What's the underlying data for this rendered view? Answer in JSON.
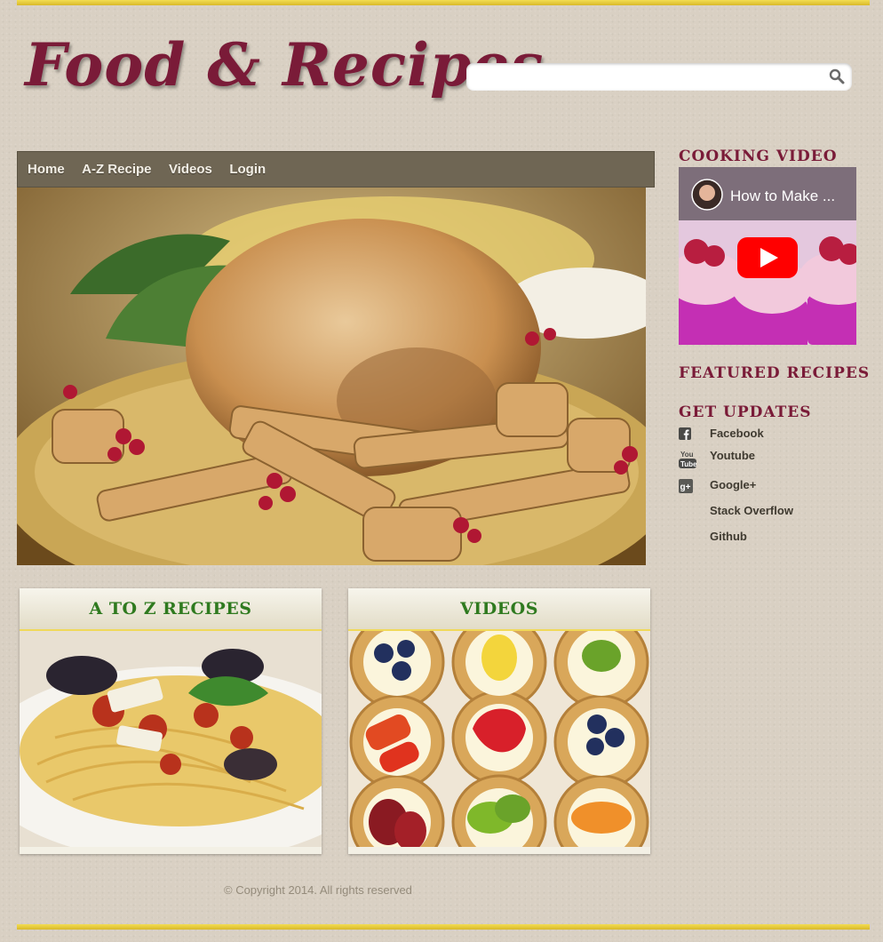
{
  "brand": {
    "logo_text": "Food & Recipes"
  },
  "search": {
    "value": "",
    "placeholder": ""
  },
  "nav": {
    "items": [
      {
        "label": "Home"
      },
      {
        "label": "A-Z Recipe"
      },
      {
        "label": "Videos"
      },
      {
        "label": "Login"
      }
    ]
  },
  "panels": {
    "az": {
      "title": "A TO Z RECIPES"
    },
    "videos": {
      "title": "VIDEOS"
    }
  },
  "sidebar": {
    "cooking_video": {
      "title": "COOKING VIDEO",
      "video_title": "How to Make ..."
    },
    "featured": {
      "title": "FEATURED RECIPES"
    },
    "updates": {
      "title": "GET UPDATES",
      "items": [
        {
          "label": "Facebook",
          "icon": "facebook-icon"
        },
        {
          "label": "Youtube",
          "icon": "youtube-icon"
        },
        {
          "label": "Google+",
          "icon": "google-plus-icon"
        },
        {
          "label": "Stack Overflow",
          "icon": ""
        },
        {
          "label": "Github",
          "icon": ""
        }
      ]
    }
  },
  "footer": {
    "copyright": "© Copyright 2014. All rights reserved"
  },
  "colors": {
    "accent": "#7a1b38",
    "nav": "#6f6654",
    "panel_title": "#2f7a1f",
    "gold": "#e8cc3c"
  }
}
